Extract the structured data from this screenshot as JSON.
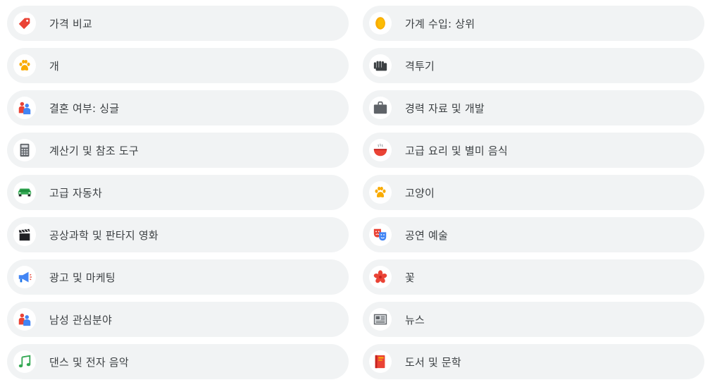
{
  "categories": {
    "left": [
      {
        "label": "가격 비교",
        "icon": "price-tag-icon",
        "color": "#ea4335"
      },
      {
        "label": "개",
        "icon": "paw-icon",
        "color": "#f9ab00"
      },
      {
        "label": "결혼 여부: 싱글",
        "icon": "people-icon",
        "color": "#4285f4"
      },
      {
        "label": "계산기 및 참조 도구",
        "icon": "calculator-icon",
        "color": "#5f6368"
      },
      {
        "label": "고급 자동차",
        "icon": "car-icon",
        "color": "#34a853"
      },
      {
        "label": "공상과학 및 판타지 영화",
        "icon": "clapperboard-icon",
        "color": "#202124"
      },
      {
        "label": "광고 및 마케팅",
        "icon": "megaphone-icon",
        "color": "#4285f4"
      },
      {
        "label": "남성 관심분야",
        "icon": "people-icon",
        "color": "#4285f4"
      },
      {
        "label": "댄스 및 전자 음악",
        "icon": "music-note-icon",
        "color": "#34a853"
      }
    ],
    "right": [
      {
        "label": "가계 수입: 상위",
        "icon": "coin-icon",
        "color": "#f9ab00"
      },
      {
        "label": "격투기",
        "icon": "fist-icon",
        "color": "#3c4043"
      },
      {
        "label": "경력 자료 및 개발",
        "icon": "briefcase-icon",
        "color": "#5f6368"
      },
      {
        "label": "고급 요리 및 별미 음식",
        "icon": "soup-bowl-icon",
        "color": "#ea4335"
      },
      {
        "label": "고양이",
        "icon": "paw-icon",
        "color": "#f9ab00"
      },
      {
        "label": "공연 예술",
        "icon": "theater-masks-icon",
        "color": "#ea4335"
      },
      {
        "label": "꽃",
        "icon": "flower-icon",
        "color": "#ea4335"
      },
      {
        "label": "뉴스",
        "icon": "newspaper-icon",
        "color": "#5f6368"
      },
      {
        "label": "도서 및 문학",
        "icon": "book-icon",
        "color": "#ea4335"
      }
    ]
  }
}
